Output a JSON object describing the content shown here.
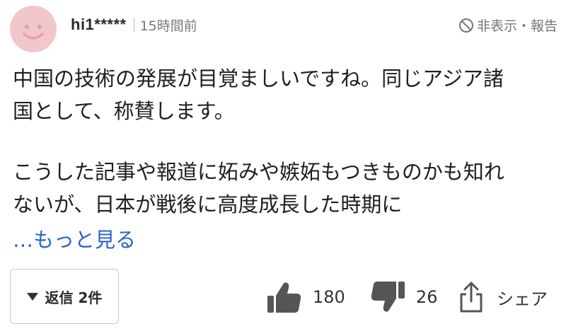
{
  "comment": {
    "username": "hi1*****",
    "timestamp": "15時間前",
    "hide_report_label": "非表示・報告",
    "body_para1": "中国の技術の発展が目覚ましいですね。同じアジア諸\n国として、称賛します。",
    "body_para2": "こうした記事や報道に妬みや嫉妬もつきものかも知れ\nないが、日本が戦後に高度成長した時期に",
    "see_more_label": "…もっと見る"
  },
  "footer": {
    "reply_label": "返信 2件",
    "like_count": "180",
    "dislike_count": "26",
    "share_label": "シェア"
  },
  "colors": {
    "avatar_bg": "#f2c7cc",
    "avatar_face": "#e9a0a8",
    "link": "#2a64c7",
    "icon_gray": "#555555"
  },
  "icons": {
    "avatar": "smiley-face-icon",
    "hide": "prohibit-icon",
    "reply": "triangle-down-icon",
    "like": "thumbs-up-icon",
    "dislike": "thumbs-down-icon",
    "share": "share-icon"
  }
}
